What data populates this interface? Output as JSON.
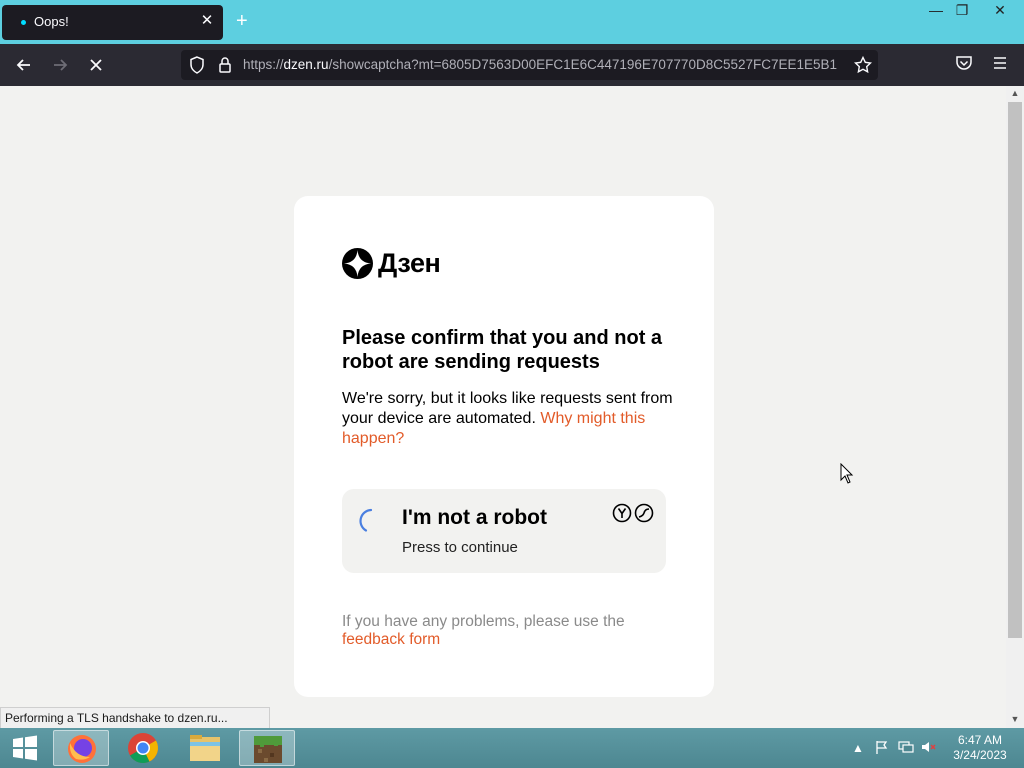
{
  "browser": {
    "tab": {
      "title": "Oops!"
    },
    "url": {
      "prefix": "https://",
      "host": "dzen.ru",
      "path": "/showcaptcha?mt=6805D7563D00EFC1E6C447196E707770D8C5527FC7EE1E5B1"
    },
    "status_text": "Performing a TLS handshake to dzen.ru..."
  },
  "page": {
    "logo_text": "Дзен",
    "heading": "Please confirm that you and not a robot are sending requests",
    "description": "We're sorry, but it looks like requests sent from your device are automated.",
    "why_link": "Why might this happen?",
    "captcha": {
      "title": "I'm not a robot",
      "subtitle": "Press to continue"
    },
    "footer_text": "If you have any problems, please use the",
    "feedback_link": "feedback form"
  },
  "taskbar": {
    "time": "6:47 AM",
    "date": "3/24/2023"
  },
  "icons": [
    "firefox-icon",
    "chrome-icon",
    "file-explorer-icon",
    "minecraft-icon"
  ],
  "colors": {
    "accent": "#e25b29",
    "tab_bg": "#1c1b22",
    "titlebar": "#5dcfe0"
  }
}
